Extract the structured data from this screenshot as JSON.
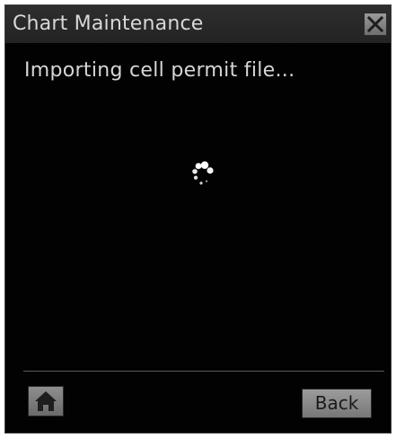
{
  "dialog": {
    "title": "Chart Maintenance",
    "message": "Importing cell permit file...",
    "back_label": "Back"
  },
  "icons": {
    "close": "close-icon",
    "home": "home-icon",
    "spinner": "loading-spinner-icon"
  },
  "colors": {
    "background": "#020202",
    "titlebar": "#2a2a2a",
    "text": "#d8d8d8",
    "button": "#8a8a8a"
  }
}
